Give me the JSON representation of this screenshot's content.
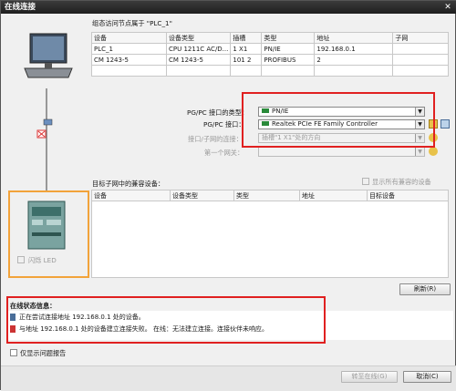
{
  "window": {
    "title": "在线连接",
    "close": "✕"
  },
  "target_table": {
    "caption": "组态访问节点属于 \"PLC_1\"",
    "headers": [
      "设备",
      "设备类型",
      "插槽",
      "类型",
      "地址",
      "子网"
    ],
    "rows": [
      [
        "PLC_1",
        "CPU 1211C AC/D...",
        "1 X1",
        "PN/IE",
        "192.168.0.1",
        ""
      ],
      [
        "CM 1243-5",
        "CM 1243-5",
        "101 2",
        "PROFIBUS",
        "2",
        ""
      ]
    ]
  },
  "pgpc": {
    "type_label": "PG/PC 接口的类型：",
    "type_value": "PN/IE",
    "iface_label": "PG/PC 接口：",
    "iface_value": "Realtek PCIe FE Family Controller",
    "subnet_label": "接口/子网的连接：",
    "subnet_value": "插槽\"1 X1\"处的方向",
    "gateway_label": "第一个网关：",
    "gateway_value": ""
  },
  "devices_table": {
    "caption": "目标子网中的兼容设备：",
    "show_all": "显示所有兼容的设备",
    "headers": [
      "设备",
      "设备类型",
      "类型",
      "地址",
      "目标设备"
    ]
  },
  "left_panel": {
    "flash_led": "闪烁 LED"
  },
  "refresh_button": "刷新(R)",
  "status": {
    "title": "在线状态信息：",
    "lines": [
      "正在尝试连接地址 192.168.0.1 处的设备。",
      "与地址 192.168.0.1 处的设备建立连接失败。 在线：无法建立连接。连接伙伴未响应。"
    ]
  },
  "errors_only": "仅显示问题报告",
  "goto_online_button": "转至在线(G)",
  "cancel_button": "取消(C)",
  "colors": {
    "highlight_red": "#e02020",
    "highlight_orange": "#f2a33a"
  }
}
